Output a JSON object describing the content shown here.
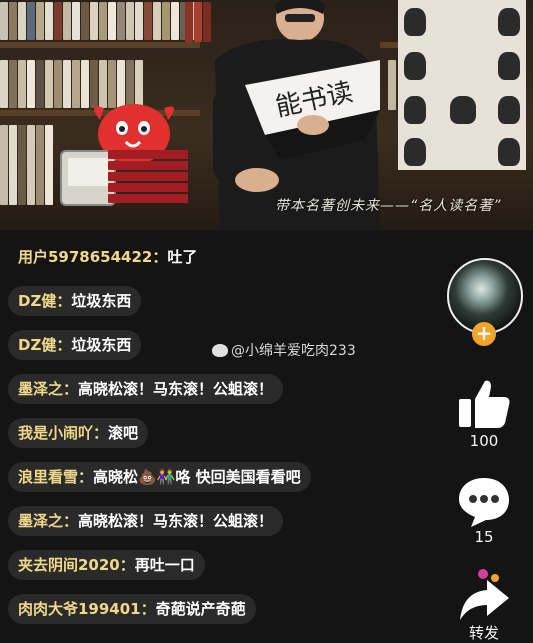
{
  "video": {
    "subtitle": "带本名著创未来——“名人读名著”",
    "fan_text": "能书读"
  },
  "comments": [
    {
      "user": "用户5978654422：",
      "text": "吐了"
    },
    {
      "user": "DZ健：",
      "text": "垃圾东西"
    },
    {
      "user": "DZ健：",
      "text": "垃圾东西"
    },
    {
      "user": "墨泽之：",
      "text": "高晓松滚！马东滚！公蛆滚！"
    },
    {
      "user": "我是小闹吖：",
      "text": "滚吧"
    },
    {
      "user": "浪里看雪：",
      "text": "高晓松💩👫咯 快回美国看看吧"
    },
    {
      "user": "墨泽之：",
      "text": "高晓松滚！马东滚！公蛆滚！"
    },
    {
      "user": "夹去阴间2020：",
      "text": "再吐一口"
    },
    {
      "user": "肉肉大爷199401：",
      "text": "奇葩说产奇葩"
    }
  ],
  "watermark": "@小绵羊爱吃肉233",
  "rail": {
    "follow_label": "+",
    "like_count": "100",
    "comment_count": "15",
    "share_label": "转发"
  },
  "colors": {
    "username": "#f0d98a",
    "follow_accent": "#f4a32b"
  }
}
